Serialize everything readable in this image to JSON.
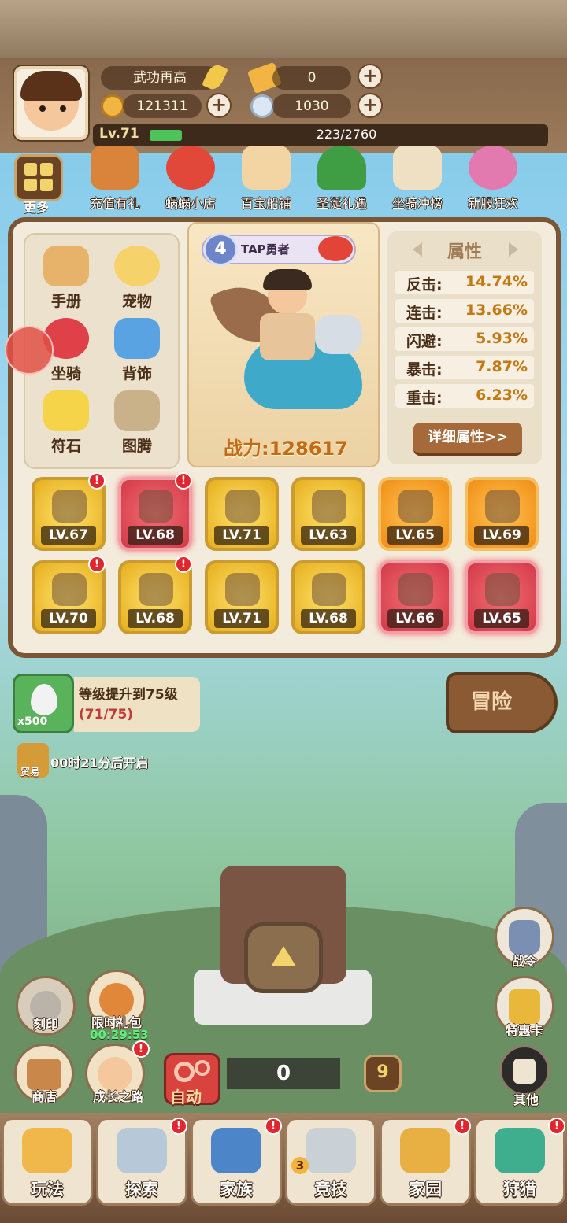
{
  "header": {
    "title_label": "武功再高",
    "ticket_count": "0",
    "coins": "121311",
    "shells": "1030",
    "level_label": "Lv.71",
    "exp_text": "223/2760",
    "exp_progress": 0.081
  },
  "events": [
    {
      "label": "更多",
      "icon": "grid-icon"
    },
    {
      "label": "充值有礼",
      "icon": "treasure-chest-icon"
    },
    {
      "label": "蜗蜗小店",
      "icon": "snail-shop-icon"
    },
    {
      "label": "百宝船铺",
      "icon": "envelope-icon"
    },
    {
      "label": "圣诞礼遇",
      "icon": "christmas-tree-icon"
    },
    {
      "label": "坐骑冲榜",
      "icon": "trophy-icon"
    },
    {
      "label": "新服狂欢",
      "icon": "characters-icon"
    }
  ],
  "menu": [
    {
      "label": "手册",
      "icon": "book-icon"
    },
    {
      "label": "宠物",
      "icon": "chick-icon"
    },
    {
      "label": "坐骑",
      "icon": "dragon-mount-icon"
    },
    {
      "label": "背饰",
      "icon": "wing-icon"
    },
    {
      "label": "符石",
      "icon": "star-stone-icon"
    },
    {
      "label": "图腾",
      "icon": "totem-icon"
    }
  ],
  "character": {
    "level": "4",
    "name": "TAP勇者",
    "power": "战力:128617"
  },
  "attributes": {
    "title": "属性",
    "rows": [
      {
        "key": "反击:",
        "value": "14.74%"
      },
      {
        "key": "连击:",
        "value": "13.66%"
      },
      {
        "key": "闪避:",
        "value": "5.93%"
      },
      {
        "key": "暴击:",
        "value": "7.87%"
      },
      {
        "key": "重击:",
        "value": "6.23%"
      }
    ],
    "detail_button": "详细属性>>"
  },
  "equipment": [
    {
      "level": "LV.67",
      "rarity": "gold",
      "alert": true
    },
    {
      "level": "LV.68",
      "rarity": "red",
      "alert": true
    },
    {
      "level": "LV.71",
      "rarity": "gold",
      "alert": false
    },
    {
      "level": "LV.63",
      "rarity": "gold",
      "alert": false
    },
    {
      "level": "LV.65",
      "rarity": "orange",
      "alert": false
    },
    {
      "level": "LV.69",
      "rarity": "orange",
      "alert": false
    },
    {
      "level": "LV.70",
      "rarity": "gold",
      "alert": true
    },
    {
      "level": "LV.68",
      "rarity": "gold",
      "alert": true
    },
    {
      "level": "LV.71",
      "rarity": "gold",
      "alert": false
    },
    {
      "level": "LV.68",
      "rarity": "gold",
      "alert": false
    },
    {
      "level": "LV.66",
      "rarity": "red",
      "alert": false
    },
    {
      "level": "LV.65",
      "rarity": "red",
      "alert": false
    }
  ],
  "quest": {
    "reward_count": "x500",
    "title": "等级提升到75级",
    "progress": "(71/75)"
  },
  "adventure_button": "冒险",
  "trade": {
    "label": "贸易",
    "timer": "00时21分后开启"
  },
  "side_left": [
    {
      "label": "刻印",
      "icon": "engrave-icon"
    },
    {
      "label": "限时礼包",
      "icon": "gift-bag-icon",
      "timer": "00:29:53"
    },
    {
      "label": "商店",
      "icon": "shop-icon"
    },
    {
      "label": "成长之路",
      "icon": "growth-icon"
    }
  ],
  "side_right": [
    {
      "label": "战令",
      "icon": "battle-pass-icon"
    },
    {
      "label": "特惠卡",
      "icon": "crown-card-icon"
    },
    {
      "label": "其他",
      "icon": "other-icon"
    }
  ],
  "auto": {
    "label": "自动",
    "counter": "0",
    "badge": "9"
  },
  "nav": [
    {
      "label": "玩法",
      "icon": "tiki-icon",
      "alert": false
    },
    {
      "label": "探索",
      "icon": "explore-icon",
      "alert": true
    },
    {
      "label": "家族",
      "icon": "clan-shield-icon",
      "alert": true
    },
    {
      "label": "竞技",
      "icon": "sword-icon",
      "alert": false,
      "badge": "3"
    },
    {
      "label": "家园",
      "icon": "home-icon",
      "alert": true
    },
    {
      "label": "狩猎",
      "icon": "hunt-dragon-icon",
      "alert": true
    }
  ],
  "colors": {
    "gold": "#e6ae1e",
    "red": "#d23a47",
    "orange": "#f08d16",
    "accent_brown": "#7b5636",
    "exp_green": "#4dc45a"
  }
}
